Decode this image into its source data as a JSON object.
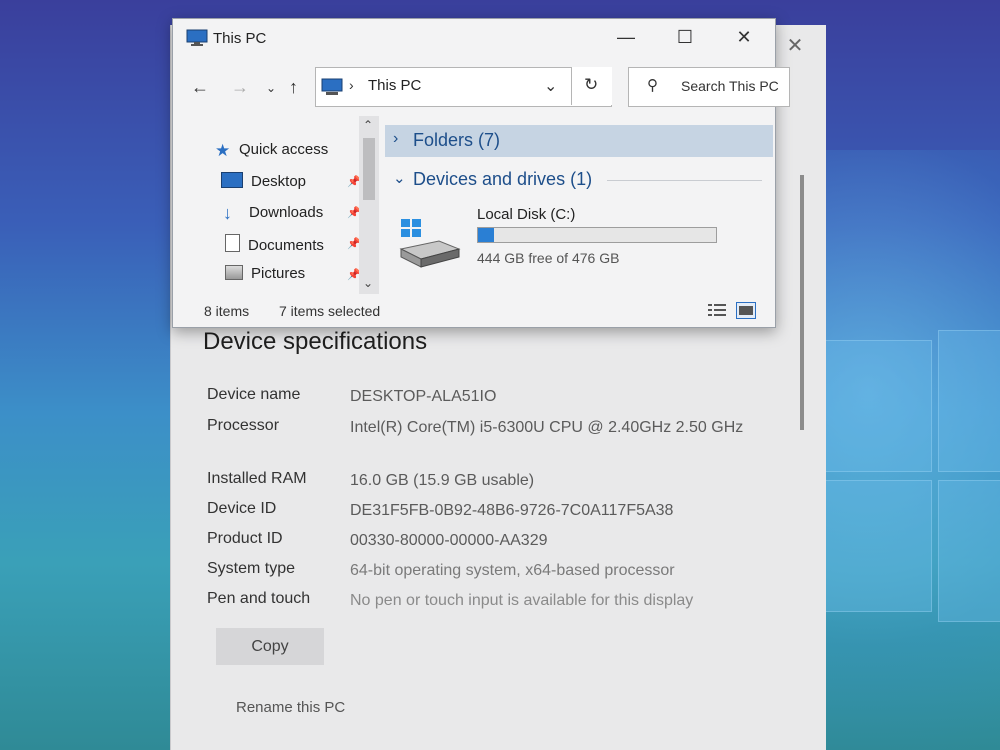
{
  "explorer": {
    "title": "This PC",
    "address": "This PC",
    "search_placeholder": "Search This PC",
    "nav": [
      {
        "label": "Quick access"
      },
      {
        "label": "Desktop"
      },
      {
        "label": "Downloads"
      },
      {
        "label": "Documents"
      },
      {
        "label": "Pictures"
      }
    ],
    "groups": {
      "folders": "Folders (7)",
      "devices": "Devices and drives (1)"
    },
    "drive": {
      "name": "Local Disk (C:)",
      "space": "444 GB free of 476 GB",
      "used_fraction": 0.067
    },
    "status": {
      "items": "8 items",
      "selected": "7 items selected"
    }
  },
  "about": {
    "section_title": "Device specifications",
    "specs": [
      {
        "label": "Device name",
        "value": "DESKTOP-ALA51IO"
      },
      {
        "label": "Processor",
        "value": "Intel(R) Core(TM) i5-6300U CPU @ 2.40GHz   2.50 GHz"
      },
      {
        "label": "Installed RAM",
        "value": "16.0 GB (15.9 GB usable)"
      },
      {
        "label": "Device ID",
        "value": "DE31F5FB-0B92-48B6-9726-7C0A117F5A38"
      },
      {
        "label": "Product ID",
        "value": "00330-80000-00000-AA329"
      },
      {
        "label": "System type",
        "value": "64-bit operating system, x64-based processor"
      },
      {
        "label": "Pen and touch",
        "value": "No pen or touch input is available for this display"
      }
    ],
    "copy_label": "Copy",
    "rename_label": "Rename this PC"
  },
  "colors": {
    "accent": "#2a7fd4",
    "group_header": "#1d4e8a"
  }
}
